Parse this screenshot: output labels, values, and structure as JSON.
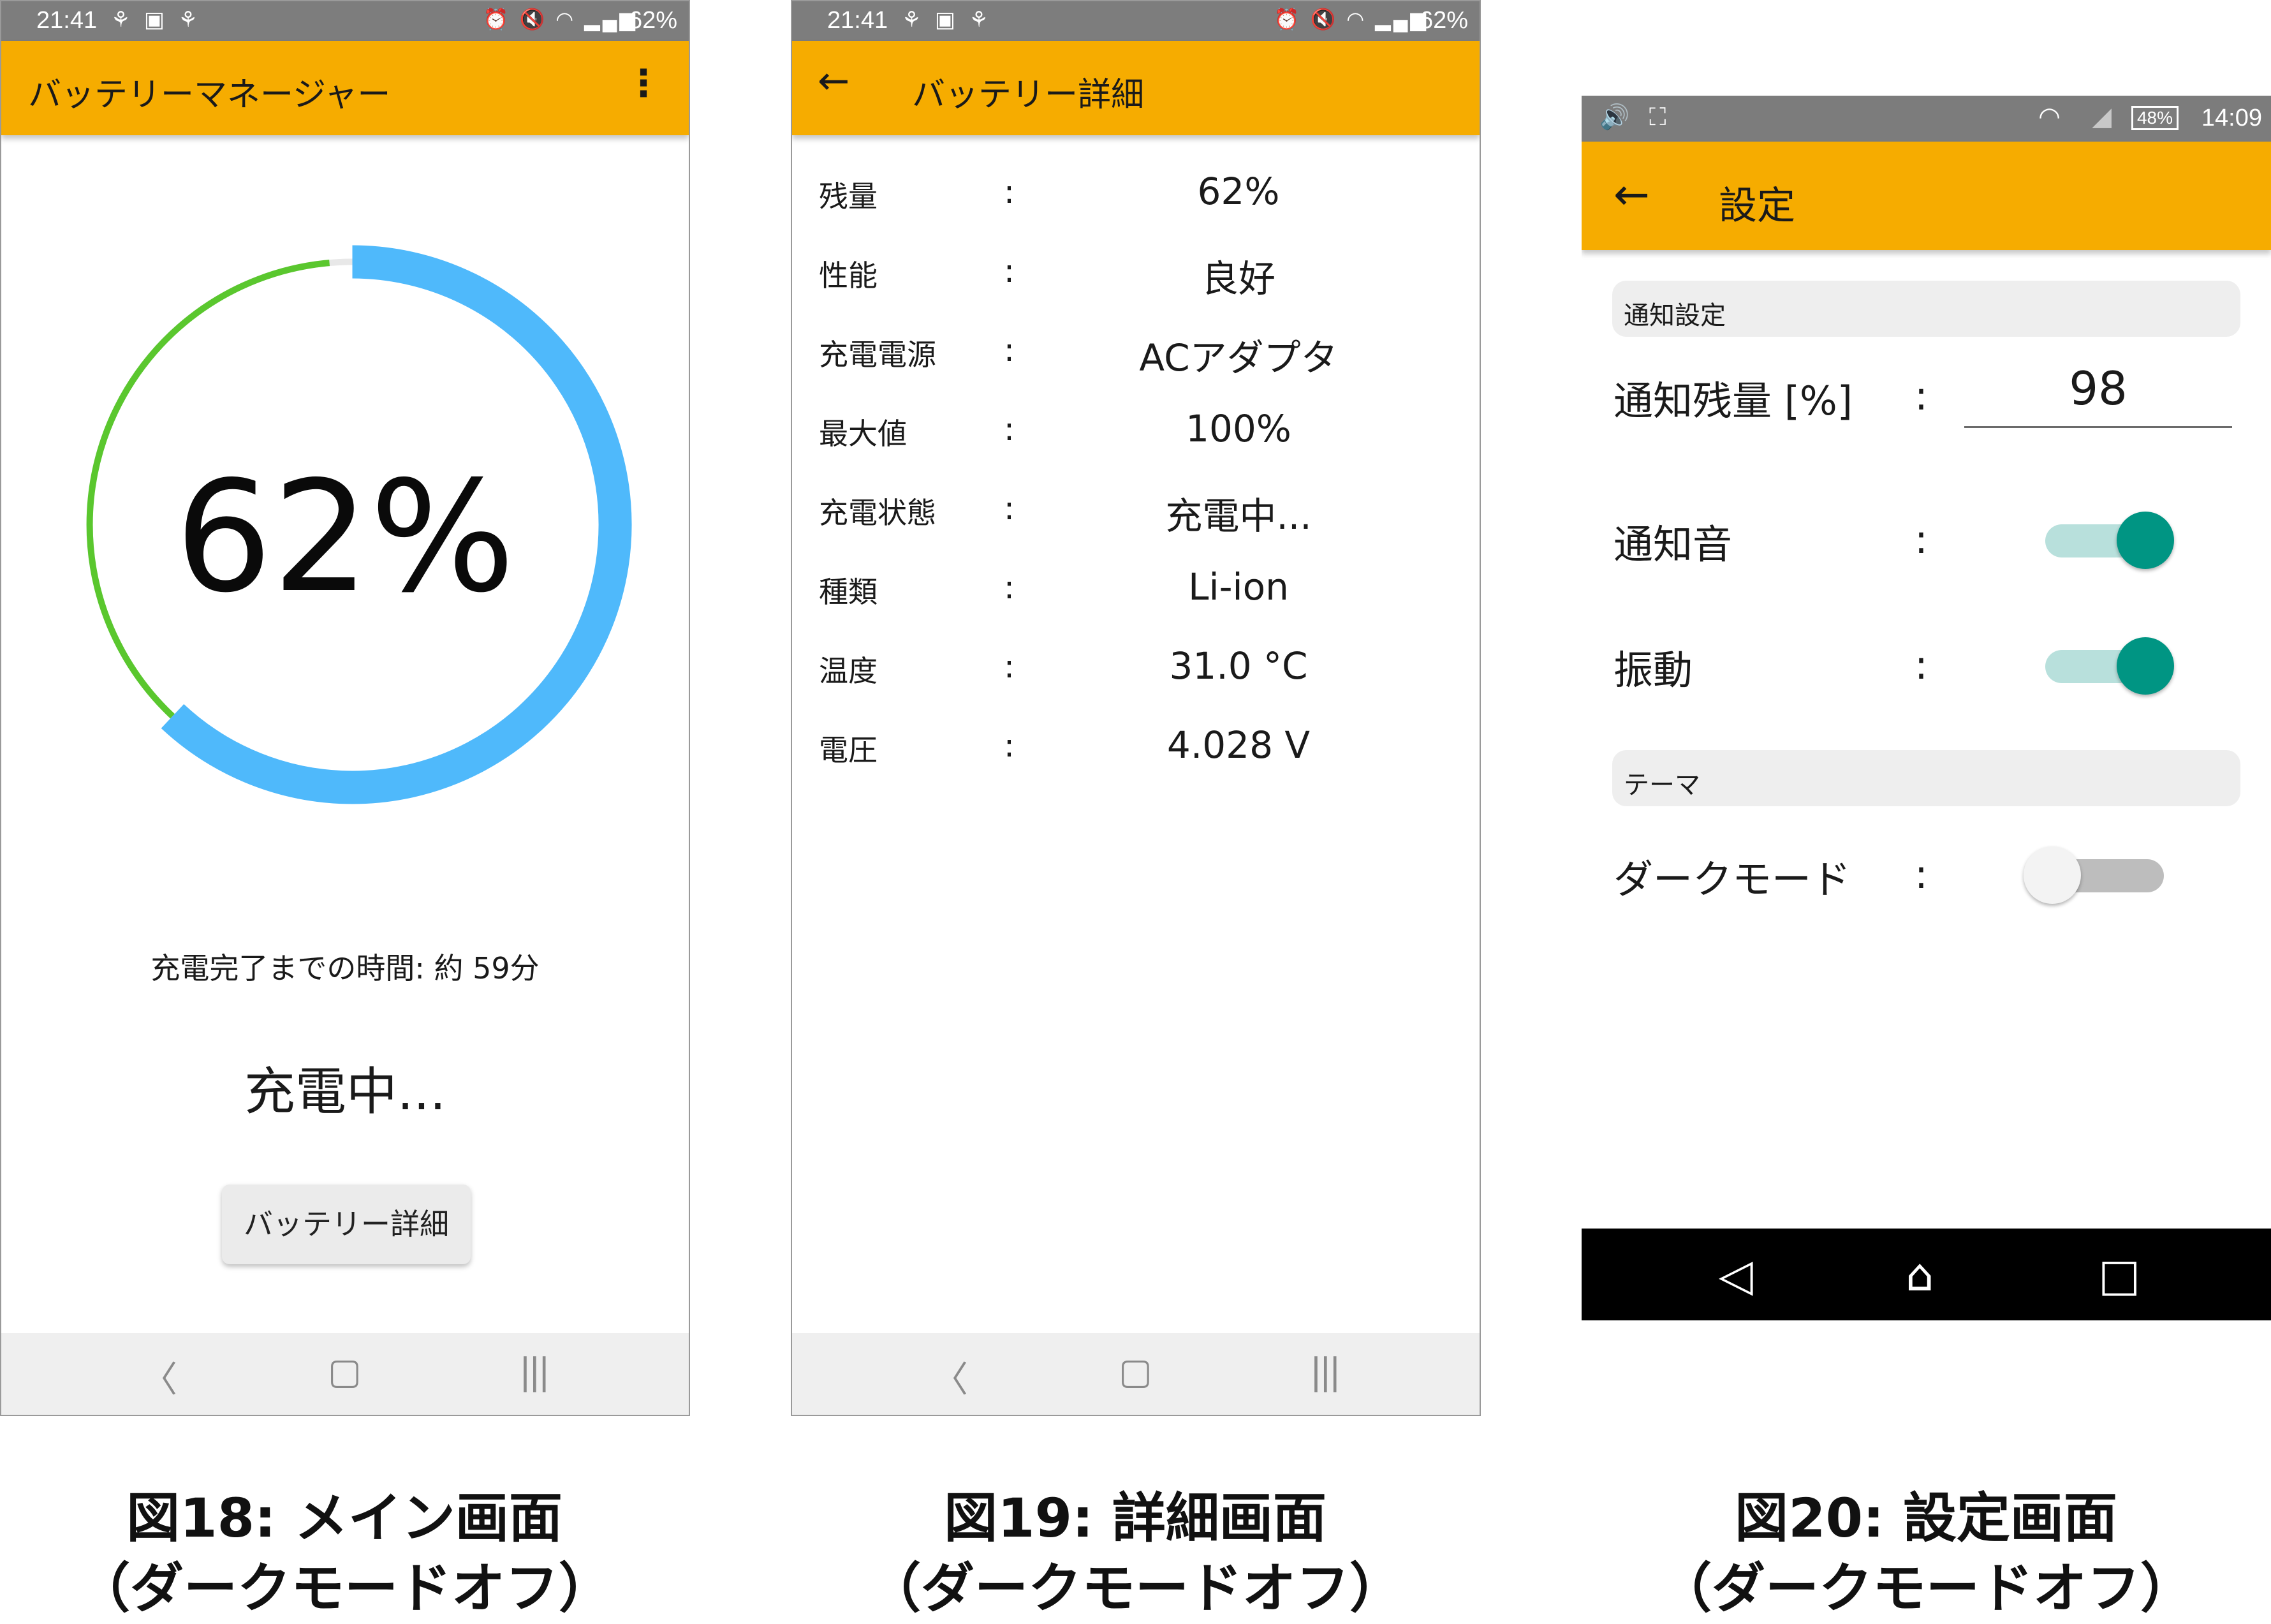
{
  "main_screen": {
    "status_bar": {
      "time": "21:41",
      "battery": "62%"
    },
    "title": "バッテリーマネージャー",
    "menu_icon": "more-vert-icon",
    "gauge": {
      "level": 62,
      "charge_color": "#4fb9fb",
      "remain_color": "#5ac72e",
      "track_color": "#e8e8e8"
    },
    "percent_text": "62%",
    "remaining_time": "充電完了までの時間: 約 59分",
    "charge_state": "充電中...",
    "detail_button": "バッテリー詳細"
  },
  "detail_screen": {
    "status_bar": {
      "time": "21:41",
      "battery": "62%"
    },
    "title": "バッテリー詳細",
    "separator": ":",
    "rows": [
      {
        "label": "残量",
        "value": "62%"
      },
      {
        "label": "性能",
        "value": "良好"
      },
      {
        "label": "充電電源",
        "value": "ACアダプタ"
      },
      {
        "label": "最大値",
        "value": "100%"
      },
      {
        "label": "充電状態",
        "value": "充電中..."
      },
      {
        "label": "種類",
        "value": "Li-ion"
      },
      {
        "label": "温度",
        "value": "31.0 °C"
      },
      {
        "label": "電圧",
        "value": "4.028 V"
      }
    ]
  },
  "settings_screen": {
    "status_bar": {
      "time": "14:09",
      "battery": "48%"
    },
    "title": "設定",
    "separator": ":",
    "notification_section": "通知設定",
    "notify_level_label": "通知残量 [%]",
    "notify_level_value": "98",
    "notify_sound_label": "通知音",
    "notify_sound_on": true,
    "vibration_label": "振動",
    "vibration_on": true,
    "theme_section": "テーマ",
    "dark_mode_label": "ダークモード",
    "dark_mode_on": false,
    "accent_color": "#009583"
  },
  "captions": [
    {
      "line1": "図18: メイン画面",
      "line2": "（ダークモードオフ）"
    },
    {
      "line1": "図19: 詳細画面",
      "line2": "（ダークモードオフ）"
    },
    {
      "line1": "図20: 設定画面",
      "line2": "（ダークモードオフ）"
    }
  ],
  "colors": {
    "app_bar": "#f6ac00",
    "status_bar": "#7d7d7d"
  }
}
